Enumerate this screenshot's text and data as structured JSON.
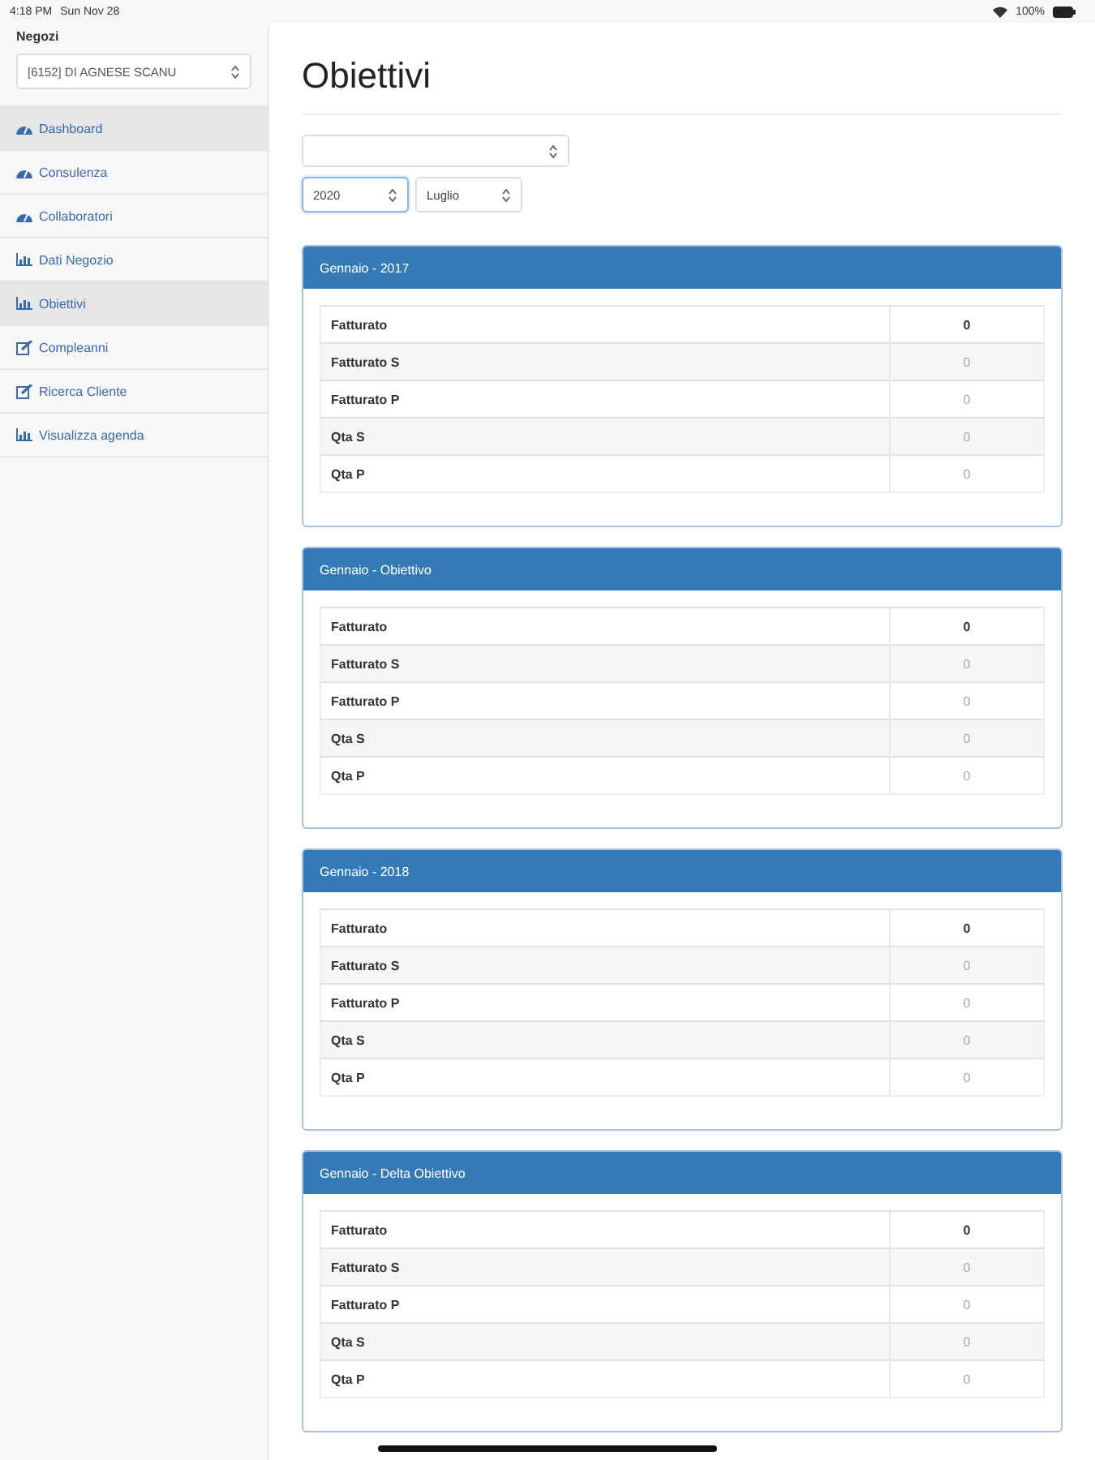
{
  "status_bar": {
    "time": "4:18 PM",
    "date": "Sun Nov 28",
    "battery": "100%"
  },
  "sidebar": {
    "label": "Negozi",
    "store_select": {
      "value": "[6152] DI AGNESE SCANU"
    },
    "items": [
      {
        "label": "Dashboard",
        "kind": "gauge",
        "highlighted": true
      },
      {
        "label": "Consulenza",
        "kind": "gauge",
        "highlighted": false
      },
      {
        "label": "Collaboratori",
        "kind": "gauge",
        "highlighted": false
      },
      {
        "label": "Dati Negozio",
        "kind": "chart",
        "highlighted": false
      },
      {
        "label": "Obiettivi",
        "kind": "chart",
        "highlighted": true
      },
      {
        "label": "Compleanni",
        "kind": "edit",
        "highlighted": false
      },
      {
        "label": "Ricerca Cliente",
        "kind": "edit",
        "highlighted": false
      },
      {
        "label": "Visualizza agenda",
        "kind": "chart",
        "highlighted": false
      }
    ]
  },
  "page": {
    "title": "Obiettivi",
    "filters": [
      {
        "kind": "wide",
        "focused": false
      },
      {
        "kind": "year",
        "value": "2020",
        "focused": true
      },
      {
        "kind": "month",
        "value": "Luglio",
        "focused": false
      }
    ],
    "panels": [
      {
        "title": "Gennaio - 2017",
        "rows": [
          {
            "label": "Fatturato",
            "value": "0",
            "bold": true
          },
          {
            "label": "Fatturato S",
            "value": "0",
            "bold": false
          },
          {
            "label": "Fatturato P",
            "value": "0",
            "bold": false
          },
          {
            "label": "Qta S",
            "value": "0",
            "bold": false
          },
          {
            "label": "Qta P",
            "value": "0",
            "bold": false
          }
        ]
      },
      {
        "title": "Gennaio - Obiettivo",
        "rows": [
          {
            "label": "Fatturato",
            "value": "0",
            "bold": true
          },
          {
            "label": "Fatturato S",
            "value": "0",
            "bold": false
          },
          {
            "label": "Fatturato P",
            "value": "0",
            "bold": false
          },
          {
            "label": "Qta S",
            "value": "0",
            "bold": false
          },
          {
            "label": "Qta P",
            "value": "0",
            "bold": false
          }
        ]
      },
      {
        "title": "Gennaio - 2018",
        "rows": [
          {
            "label": "Fatturato",
            "value": "0",
            "bold": true
          },
          {
            "label": "Fatturato S",
            "value": "0",
            "bold": false
          },
          {
            "label": "Fatturato P",
            "value": "0",
            "bold": false
          },
          {
            "label": "Qta S",
            "value": "0",
            "bold": false
          },
          {
            "label": "Qta P",
            "value": "0",
            "bold": false
          }
        ]
      },
      {
        "title": "Gennaio - Delta Obiettivo",
        "rows": [
          {
            "label": "Fatturato",
            "value": "0",
            "bold": true
          },
          {
            "label": "Fatturato S",
            "value": "0",
            "bold": false
          },
          {
            "label": "Fatturato P",
            "value": "0",
            "bold": false
          },
          {
            "label": "Qta S",
            "value": "0",
            "bold": false
          },
          {
            "label": "Qta P",
            "value": "0",
            "bold": false
          }
        ]
      }
    ]
  }
}
